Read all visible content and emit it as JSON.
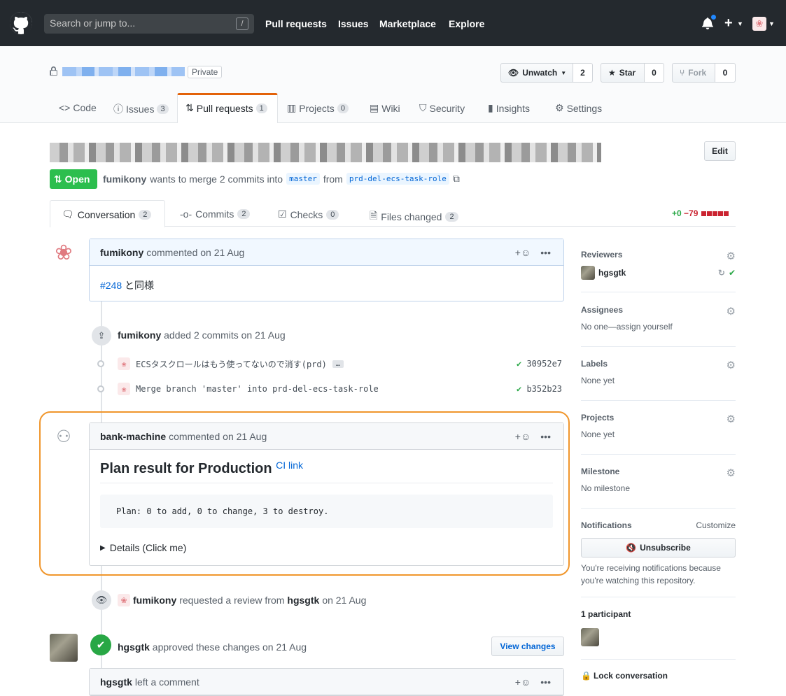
{
  "header": {
    "search_placeholder": "Search or jump to...",
    "search_key": "/",
    "nav": [
      "Pull requests",
      "Issues",
      "Marketplace",
      "Explore"
    ]
  },
  "repo": {
    "visibility": "Private",
    "watch_label": "Unwatch",
    "watch_count": "2",
    "star_label": "Star",
    "star_count": "0",
    "fork_label": "Fork",
    "fork_count": "0",
    "tabs": [
      {
        "label": "Code",
        "icon": "code-icon"
      },
      {
        "label": "Issues",
        "count": "3",
        "icon": "issue-icon"
      },
      {
        "label": "Pull requests",
        "count": "1",
        "icon": "pull-request-icon"
      },
      {
        "label": "Projects",
        "count": "0",
        "icon": "project-icon"
      },
      {
        "label": "Wiki",
        "icon": "book-icon"
      },
      {
        "label": "Security",
        "icon": "shield-icon"
      },
      {
        "label": "Insights",
        "icon": "graph-icon"
      },
      {
        "label": "Settings",
        "icon": "gear-icon"
      }
    ]
  },
  "pr": {
    "edit_label": "Edit",
    "state": "Open",
    "author": "fumikony",
    "merge_text": "wants to merge 2 commits into",
    "base": "master",
    "from_text": "from",
    "head": "prd-del-ecs-task-role",
    "tabs": [
      {
        "label": "Conversation",
        "count": "2"
      },
      {
        "label": "Commits",
        "count": "2"
      },
      {
        "label": "Checks",
        "count": "0"
      },
      {
        "label": "Files changed",
        "count": "2"
      }
    ],
    "additions": "+0",
    "deletions": "−79"
  },
  "timeline": {
    "comment1": {
      "author": "fumikony",
      "meta": "commented on 21 Aug",
      "ref": "#248",
      "body": "と同様"
    },
    "commits_event": {
      "author": "fumikony",
      "text": "added 2 commits",
      "date": "on 21 Aug"
    },
    "commits": [
      {
        "message": "ECSタスクロールはもう使ってないので消す(prd)",
        "sha": "30952e7",
        "has_more": "…"
      },
      {
        "message": "Merge branch 'master' into prd-del-ecs-task-role",
        "sha": "b352b23"
      }
    ],
    "comment2": {
      "author": "bank-machine",
      "meta": "commented on 21 Aug",
      "heading": "Plan result for Production",
      "link": "CI link",
      "plan": "Plan: 0 to add, 0 to change, 3 to destroy.",
      "details": "Details (Click me)"
    },
    "review_request": {
      "author": "fumikony",
      "text": "requested a review from",
      "reviewer": "hgsgtk",
      "date": "on 21 Aug"
    },
    "approval": {
      "author": "hgsgtk",
      "text": "approved these changes",
      "date": "on 21 Aug",
      "button": "View changes"
    },
    "comment3": {
      "author": "hgsgtk",
      "meta": "left a comment"
    }
  },
  "sidebar": {
    "reviewers_label": "Reviewers",
    "reviewer": "hgsgtk",
    "assignees_label": "Assignees",
    "assignees_value": "No one—assign yourself",
    "labels_label": "Labels",
    "labels_value": "None yet",
    "projects_label": "Projects",
    "projects_value": "None yet",
    "milestone_label": "Milestone",
    "milestone_value": "No milestone",
    "notifications_label": "Notifications",
    "customize": "Customize",
    "unsubscribe": "Unsubscribe",
    "notif_reason": "You're receiving notifications because you're watching this repository.",
    "participants": "1 participant",
    "lock": "Lock conversation"
  },
  "colors": {
    "accent": "#0366d6",
    "open": "#2cbe4e",
    "highlight": "#f0962c",
    "header": "#24292e"
  }
}
